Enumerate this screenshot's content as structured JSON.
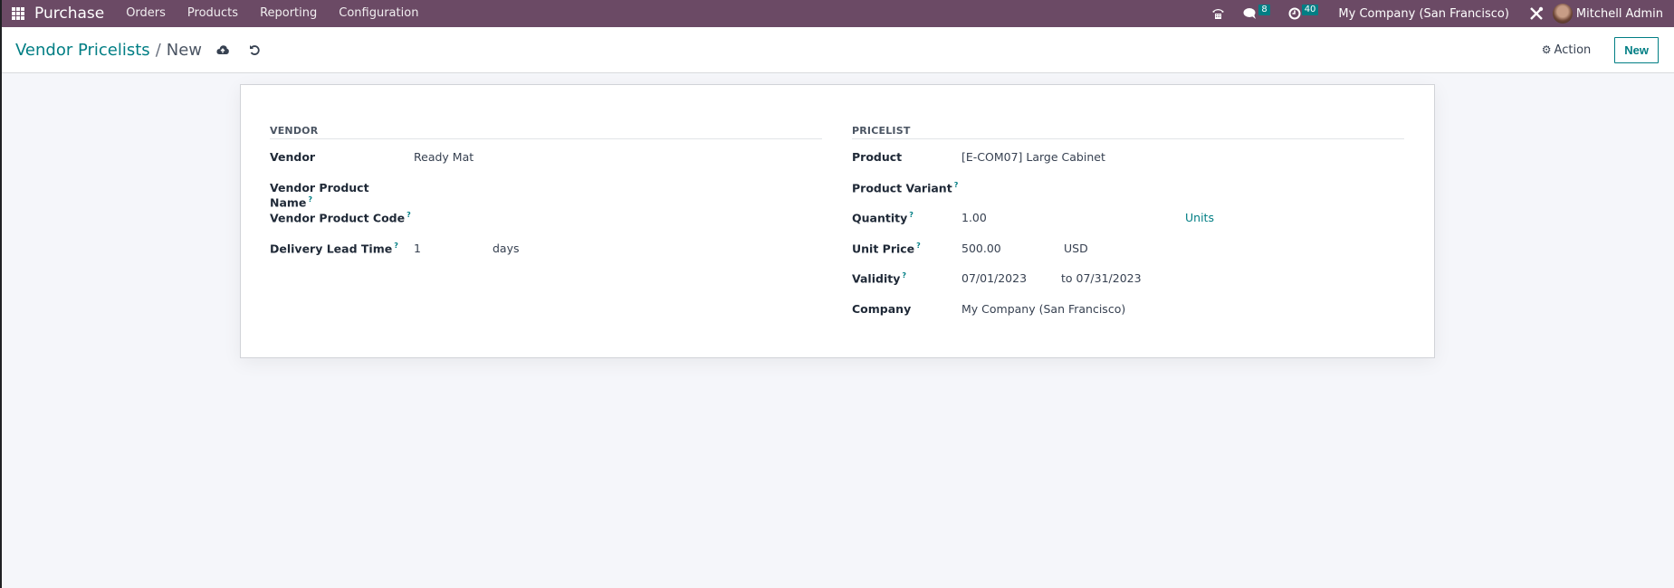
{
  "navbar": {
    "app_name": "Purchase",
    "menu": [
      "Orders",
      "Products",
      "Reporting",
      "Configuration"
    ],
    "messages_count": "8",
    "activities_count": "40",
    "company": "My Company (San Francisco)",
    "user": "Mitchell Admin",
    "colors": {
      "background": "#6b4a65",
      "badge": "#017e84"
    }
  },
  "control_panel": {
    "breadcrumb_parent": "Vendor Pricelists",
    "breadcrumb_separator": "/",
    "breadcrumb_current": "New",
    "action_label": "Action",
    "new_label": "New"
  },
  "form": {
    "vendor_group": {
      "title": "VENDOR",
      "fields": [
        {
          "label": "Vendor",
          "help": false,
          "value": "Ready Mat"
        },
        {
          "label": "Vendor Product Name",
          "help": true,
          "value": ""
        },
        {
          "label": "Vendor Product Code",
          "help": true,
          "value": ""
        },
        {
          "label": "Delivery Lead Time",
          "help": true,
          "value": "1",
          "unit": "days"
        }
      ]
    },
    "pricelist_group": {
      "title": "PRICELIST",
      "fields": [
        {
          "label": "Product",
          "help": false,
          "value": "[E-COM07] Large Cabinet"
        },
        {
          "label": "Product Variant",
          "help": true,
          "value": ""
        },
        {
          "label": "Quantity",
          "help": true,
          "value": "1.00",
          "unit": "Units"
        },
        {
          "label": "Unit Price",
          "help": true,
          "value": "500.00",
          "unit": "USD"
        },
        {
          "label": "Validity",
          "help": true,
          "value": "07/01/2023",
          "value_to": "to 07/31/2023"
        },
        {
          "label": "Company",
          "help": false,
          "value": "My Company (San Francisco)"
        }
      ]
    },
    "help_marker": "?"
  },
  "icons": {
    "apps": "grid-icon",
    "phone": "phone-icon",
    "messages": "chat-icon",
    "activities": "clock-icon",
    "debug": "tools-icon",
    "save": "cloud-upload-icon",
    "discard": "undo-icon",
    "action": "gear-icon"
  }
}
